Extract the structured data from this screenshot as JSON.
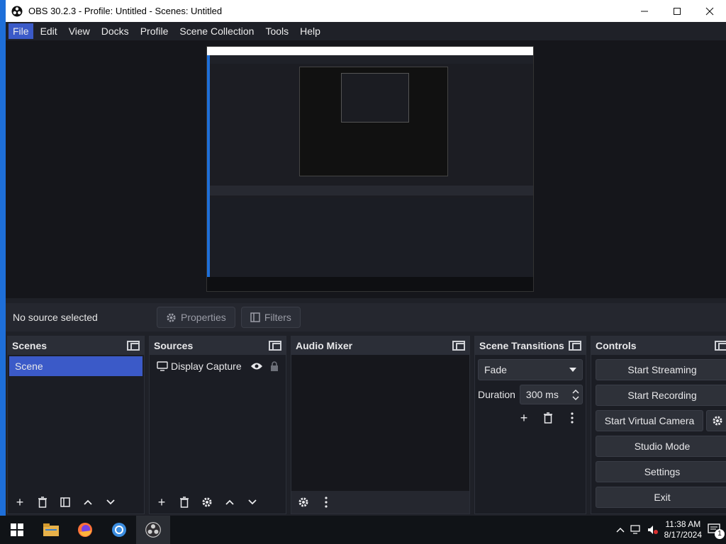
{
  "window": {
    "title": "OBS 30.2.3 - Profile: Untitled - Scenes: Untitled"
  },
  "menu": [
    "File",
    "Edit",
    "View",
    "Docks",
    "Profile",
    "Scene Collection",
    "Tools",
    "Help"
  ],
  "source_bar": {
    "status": "No source selected",
    "properties": "Properties",
    "filters": "Filters"
  },
  "scenes": {
    "title": "Scenes",
    "items": [
      "Scene"
    ]
  },
  "sources": {
    "title": "Sources",
    "items": [
      {
        "label": "Display Capture"
      }
    ]
  },
  "audio_mixer": {
    "title": "Audio Mixer"
  },
  "transitions": {
    "title": "Scene Transitions",
    "selected": "Fade",
    "duration_label": "Duration",
    "duration_value": "300 ms"
  },
  "controls": {
    "title": "Controls",
    "start_streaming": "Start Streaming",
    "start_recording": "Start Recording",
    "start_virtual_camera": "Start Virtual Camera",
    "studio_mode": "Studio Mode",
    "settings": "Settings",
    "exit": "Exit"
  },
  "taskbar": {
    "time": "11:38 AM",
    "date": "8/17/2024",
    "notification_count": "1"
  },
  "colors": {
    "accent": "#3b5ac8",
    "window_bg": "#1f2128",
    "dock_bg": "#1b1d24"
  }
}
